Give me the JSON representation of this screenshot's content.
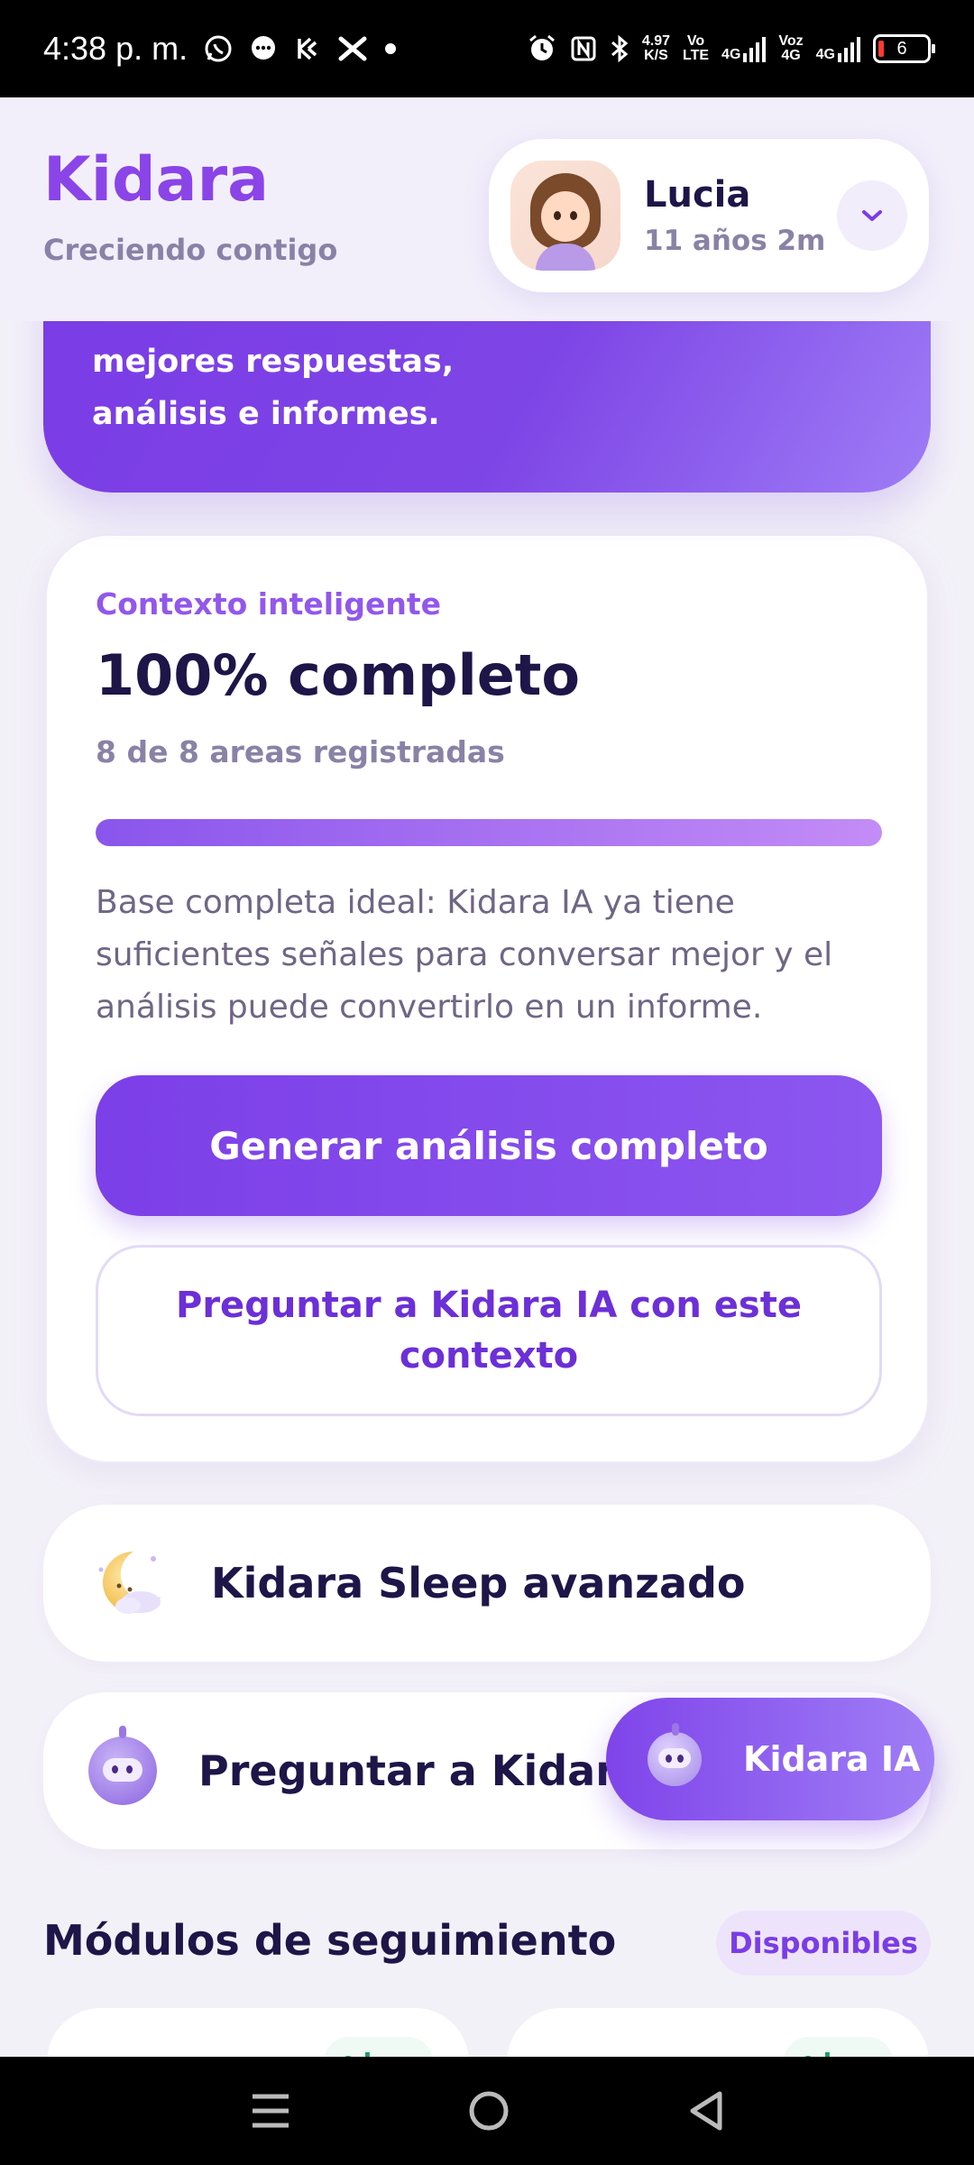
{
  "status_bar": {
    "time": "4:38 p. m.",
    "speed_value": "4.97",
    "speed_unit": "K/S",
    "volte_top": "Vo",
    "volte_bottom": "LTE",
    "net1": "4G",
    "voz_top": "Voz",
    "voz_bottom": "4G",
    "net2": "4G",
    "battery": "6"
  },
  "header": {
    "brand": "Kidara",
    "tagline": "Creciendo contigo",
    "profile": {
      "name": "Lucia",
      "age": "11 años 2m"
    }
  },
  "promo": {
    "line1": "mejores respuestas,",
    "line2": "análisis e informes."
  },
  "context": {
    "label": "Contexto inteligente",
    "title": "100% completo",
    "subtitle": "8 de 8 areas registradas",
    "progress": 1.0,
    "description": "Base completa ideal: Kidara IA ya tiene suficientes señales para conversar mejor y el análisis puede convertirlo en un informe.",
    "primary_button": "Generar análisis completo",
    "secondary_button": "Preguntar a Kidara IA con este contexto"
  },
  "rows": {
    "sleep_label": "Kidara Sleep avanzado",
    "ask_label": "Preguntar a Kidara"
  },
  "fab": {
    "label": "Kidara IA"
  },
  "modules": {
    "title": "Módulos de seguimiento",
    "badge": "Disponibles",
    "card_badge": "hoy"
  },
  "colors": {
    "brand": "#8a44e8",
    "accent": "#7c3fe8",
    "success": "#1e9c63"
  }
}
